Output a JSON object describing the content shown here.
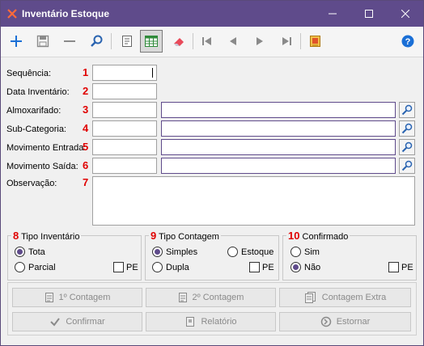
{
  "window": {
    "title": "Inventário Estoque"
  },
  "form": {
    "sequencia": {
      "label": "Sequência:",
      "num": "1"
    },
    "data_inventario": {
      "label": "Data Inventário:",
      "num": "2"
    },
    "almoxarifado": {
      "label": "Almoxarifado:",
      "num": "3"
    },
    "sub_categoria": {
      "label": "Sub-Categoria:",
      "num": "4"
    },
    "movimento_entrada": {
      "label": "Movimento Entrada:",
      "num": "5"
    },
    "movimento_saida": {
      "label": "Movimento Saída:",
      "num": "6"
    },
    "observacao": {
      "label": "Observação:",
      "num": "7"
    }
  },
  "groups": {
    "tipo_inventario": {
      "num": "8",
      "title": "Tipo Inventário",
      "options": [
        "Tota",
        "Parcial"
      ],
      "selected": "Tota",
      "pe_label": "PE"
    },
    "tipo_contagem": {
      "num": "9",
      "title": "Tipo Contagem",
      "options": [
        "Simples",
        "Estoque",
        "Dupla"
      ],
      "selected": "Simples",
      "pe_label": "PE"
    },
    "confirmado": {
      "num": "10",
      "title": "Confirmado",
      "options": [
        "Sim",
        "Não"
      ],
      "selected": "Não",
      "pe_label": "PE"
    }
  },
  "actions": {
    "contagem1": "1º Contagem",
    "contagem2": "2º Contagem",
    "contagem_extra": "Contagem Extra",
    "confirmar": "Confirmar",
    "relatorio": "Relatório",
    "estornar": "Estornar"
  },
  "colors": {
    "titlebar": "#5f4b8b",
    "accent": "#1a6fd6",
    "required_number": "#e00000"
  }
}
